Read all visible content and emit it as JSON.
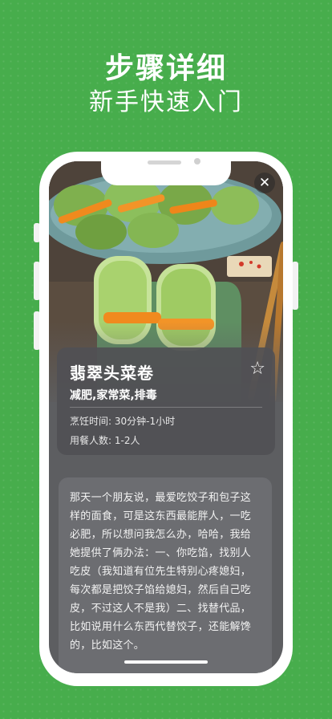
{
  "headline": {
    "title": "步骤详细",
    "subtitle": "新手快速入门"
  },
  "recipe": {
    "name": "翡翠头菜卷",
    "tags": "减肥,家常菜,排毒",
    "cook_time": "烹饪时间: 30分钟-1小时",
    "servings": "用餐人数: 1-2人",
    "description": "那天一个朋友说，最爱吃饺子和包子这样的面食，可是这东西最能胖人，一吃必肥，所以想问我怎么办，哈哈，我给她提供了俩办法：一、你吃馅，找别人吃皮（我知道有位先生特别心疼媳妇，每次都是把饺子馅给媳妇，然后自己吃皮，不过这人不是我）二、找替代品，比如说用什么东西代替饺子，还能解馋的，比如这个。"
  },
  "icons": {
    "close": "close-icon",
    "favorite": "star-outline-icon"
  },
  "colors": {
    "background": "#47ad4c",
    "card": "#505054",
    "carrot": "#f08a1e",
    "cabbage": "#8fc35a"
  }
}
